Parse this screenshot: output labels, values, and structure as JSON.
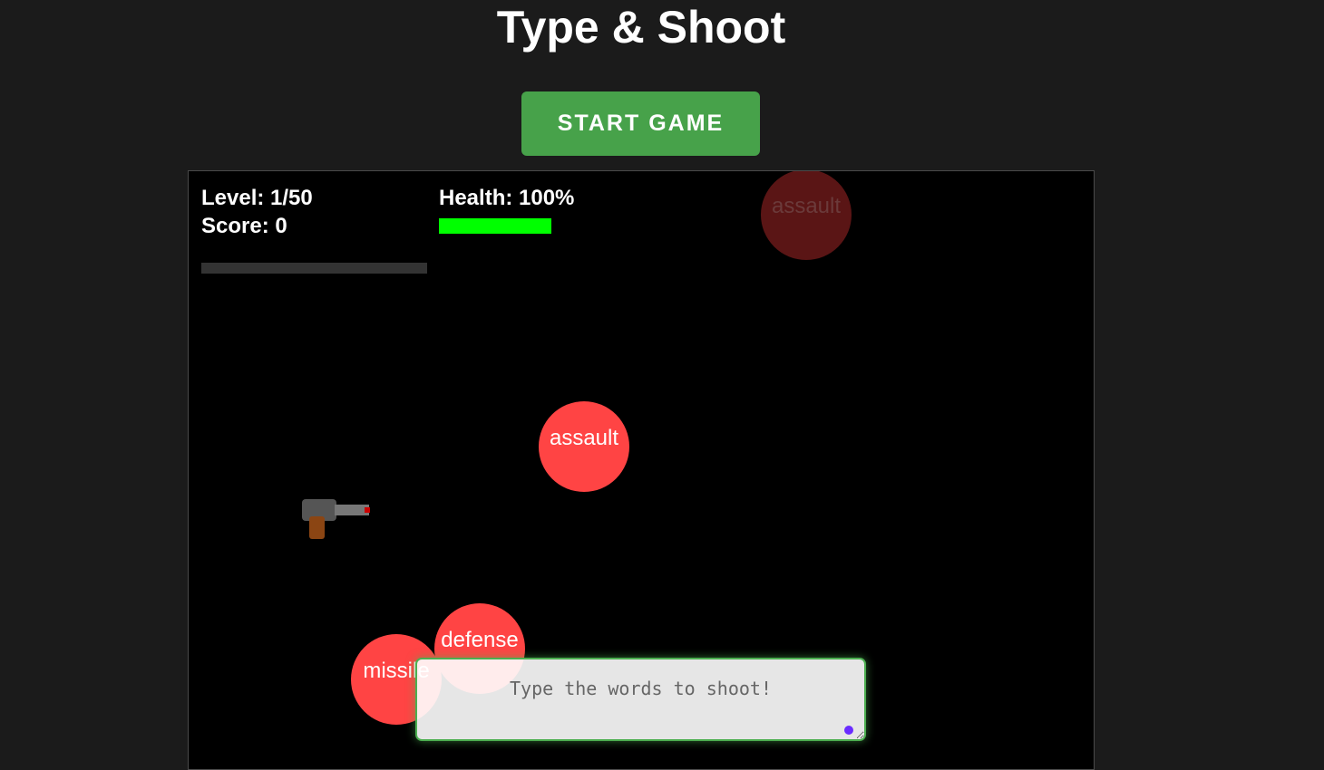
{
  "title": "Type & Shoot",
  "start_button_label": "START GAME",
  "hud": {
    "level": "Level: 1/50",
    "score": "Score: 0",
    "health": "Health: 100%",
    "health_fraction": 1.0,
    "level_progress_fraction": 0.0
  },
  "enemies": [
    {
      "word": "assault",
      "state": "faded"
    },
    {
      "word": "assault",
      "state": "active"
    },
    {
      "word": "defense",
      "state": "active"
    },
    {
      "word": "missile",
      "state": "active"
    }
  ],
  "input": {
    "placeholder": "Type the words to shoot!",
    "value": ""
  },
  "colors": {
    "background": "#1b1b1b",
    "game_area": "#000000",
    "start_button": "#47a24a",
    "enemy": "#ff4444",
    "health": "#00ff00",
    "input_border": "#4caf50"
  },
  "icons": [
    "gun-icon",
    "recording-dot-icon"
  ]
}
